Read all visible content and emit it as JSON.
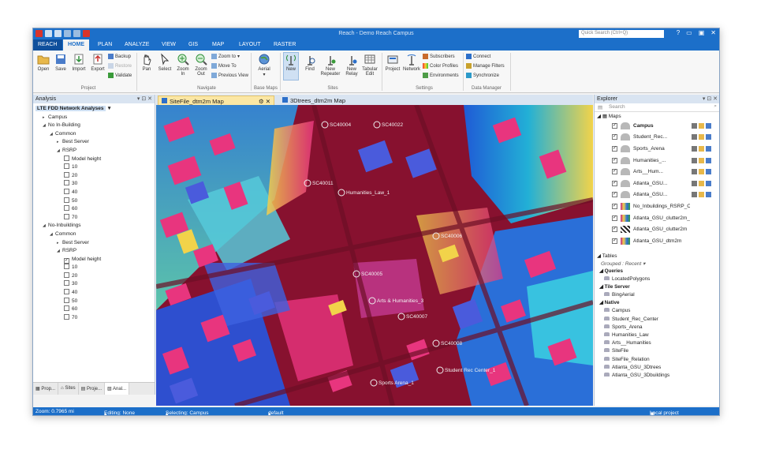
{
  "window": {
    "title": "Reach - Demo Reach Campus",
    "quick_search_placeholder": "Quick Search (Ctrl+Q)"
  },
  "ribbon_tabs": [
    {
      "label": "REACH"
    },
    {
      "label": "HOME"
    },
    {
      "label": "PLAN"
    },
    {
      "label": "ANALYZE"
    },
    {
      "label": "VIEW"
    },
    {
      "label": "GIS"
    },
    {
      "label": "MAP"
    },
    {
      "label": "LAYOUT"
    },
    {
      "label": "RASTER"
    }
  ],
  "ribbon": {
    "project": {
      "open": "Open",
      "save": "Save",
      "import": "Import",
      "export": "Export",
      "backup": "Backup",
      "restore": "Restore",
      "validate": "Validate",
      "group": "Project"
    },
    "navigate": {
      "pan": "Pan",
      "select": "Select",
      "zoom_in": "Zoom In",
      "zoom_out": "Zoom Out",
      "zoom_to": "Zoom to",
      "move_to": "Move To",
      "previous_view": "Previous View",
      "group": "Navigate"
    },
    "base_maps": {
      "aerial": "Aerial",
      "group": "Base Maps"
    },
    "sites": {
      "new": "New",
      "find": "Find",
      "new_repeater": "New Repeater",
      "new_relay": "New Relay",
      "tabular_edit": "Tabular Edit",
      "group": "Sites"
    },
    "settings": {
      "project": "Project",
      "network": "Network",
      "subscribers": "Subscribers",
      "color_profiles": "Color Profiles",
      "environments": "Environments",
      "group": "Settings"
    },
    "data_manager": {
      "connect": "Connect",
      "manage_filters": "Manage Filters",
      "synchronize": "Synchronize",
      "group": "Data Manager"
    }
  },
  "analysis_panel": {
    "title": "Analysis",
    "tree": [
      {
        "label": "LTE FDD Network Analyses",
        "level": 0,
        "type": "root"
      },
      {
        "label": "Campus",
        "level": 1,
        "arrow": "▸"
      },
      {
        "label": "No In-Building",
        "level": 1,
        "arrow": "◢"
      },
      {
        "label": "Common",
        "level": 2,
        "arrow": "◢"
      },
      {
        "label": "Best Server",
        "level": 3,
        "arrow": "▸"
      },
      {
        "label": "RSRP",
        "level": 3,
        "arrow": "◢"
      },
      {
        "label": "Model height",
        "level": 4,
        "checked": false
      },
      {
        "label": "10",
        "level": 4,
        "checked": false
      },
      {
        "label": "20",
        "level": 4,
        "checked": false
      },
      {
        "label": "30",
        "level": 4,
        "checked": false
      },
      {
        "label": "40",
        "level": 4,
        "checked": false
      },
      {
        "label": "50",
        "level": 4,
        "checked": false
      },
      {
        "label": "60",
        "level": 4,
        "checked": false
      },
      {
        "label": "70",
        "level": 4,
        "checked": false
      },
      {
        "label": "No-Inbuildings",
        "level": 1,
        "arrow": "◢"
      },
      {
        "label": "Common",
        "level": 2,
        "arrow": "◢"
      },
      {
        "label": "Best Server",
        "level": 3,
        "arrow": "▸"
      },
      {
        "label": "RSRP",
        "level": 3,
        "arrow": "◢"
      },
      {
        "label": "Model height",
        "level": 4,
        "checked": true
      },
      {
        "label": "10",
        "level": 4,
        "checked": false
      },
      {
        "label": "20",
        "level": 4,
        "checked": false
      },
      {
        "label": "30",
        "level": 4,
        "checked": false
      },
      {
        "label": "40",
        "level": 4,
        "checked": false
      },
      {
        "label": "50",
        "level": 4,
        "checked": false
      },
      {
        "label": "60",
        "level": 4,
        "checked": false
      },
      {
        "label": "70",
        "level": 4,
        "checked": false
      }
    ],
    "bottom_tabs": [
      {
        "label": "Prop..."
      },
      {
        "label": "Sites"
      },
      {
        "label": "Proje..."
      },
      {
        "label": "Anal..."
      }
    ]
  },
  "doc_tabs": [
    {
      "label": "SiteFile_dtm2m Map"
    },
    {
      "label": "3Dtrees_dtm2m Map"
    }
  ],
  "map": {
    "labels": [
      {
        "text": "SC40004"
      },
      {
        "text": "SC40022"
      },
      {
        "text": "SC40011"
      },
      {
        "text": "Humanities_Law_1"
      },
      {
        "text": "SC40006"
      },
      {
        "text": "SC40005"
      },
      {
        "text": "Arts & Humanities_3"
      },
      {
        "text": "SC40007"
      },
      {
        "text": "SC40008"
      },
      {
        "text": "Student Rec Center_1"
      },
      {
        "text": "Sports Arena_1"
      }
    ]
  },
  "explorer": {
    "title": "Explorer",
    "search_placeholder": "Search",
    "maps_label": "Maps",
    "layers": [
      {
        "label": "Campus",
        "bold": true,
        "icon": "building"
      },
      {
        "label": "Student_Rec...",
        "icon": "building"
      },
      {
        "label": "Sports_Arena",
        "icon": "building"
      },
      {
        "label": "Humanities_...",
        "icon": "building"
      },
      {
        "label": "Arts__Hum...",
        "icon": "building"
      },
      {
        "label": "Atlanta_GSU...",
        "icon": "building"
      },
      {
        "label": "Atlanta_GSU...",
        "icon": "building"
      },
      {
        "label": "No_Inbuildings_RSRP_C...",
        "icon": "raster"
      },
      {
        "label": "Atlanta_GSU_clutter2m_...",
        "icon": "raster"
      },
      {
        "label": "Atlanta_GSU_clutter2m",
        "icon": "checker"
      },
      {
        "label": "Atlanta_GSU_dtm2m",
        "icon": "raster"
      }
    ],
    "tables_label": "Tables",
    "grouped": "Grouped : Recent",
    "table_tree": [
      {
        "label": "Queries",
        "head": true
      },
      {
        "label": "LocatedPolygons"
      },
      {
        "label": "Tile Server",
        "head": true
      },
      {
        "label": "BingAerial"
      },
      {
        "label": "Native",
        "head": true
      },
      {
        "label": "Campus"
      },
      {
        "label": "Student_Rec_Center"
      },
      {
        "label": "Sports_Arena"
      },
      {
        "label": "Humanities_Law"
      },
      {
        "label": "Arts__Humanities"
      },
      {
        "label": "SiteFile"
      },
      {
        "label": "SiteFile_Relation"
      },
      {
        "label": "Atlanta_GSU_3Dtrees"
      },
      {
        "label": "Atlanta_GSU_3Dbuildings"
      }
    ]
  },
  "status": {
    "zoom": "Zoom: 0.7965 mi",
    "editing": "Editing: None",
    "selecting": "Selecting: Campus",
    "layout": "default",
    "project": "Local project"
  },
  "colors": {
    "accent": "#1c6fc9",
    "heat_core": "#87112f",
    "building_pink": "#e8357e",
    "building_blue": "#4a5bdc",
    "heat_yellow": "#f2d34a"
  }
}
